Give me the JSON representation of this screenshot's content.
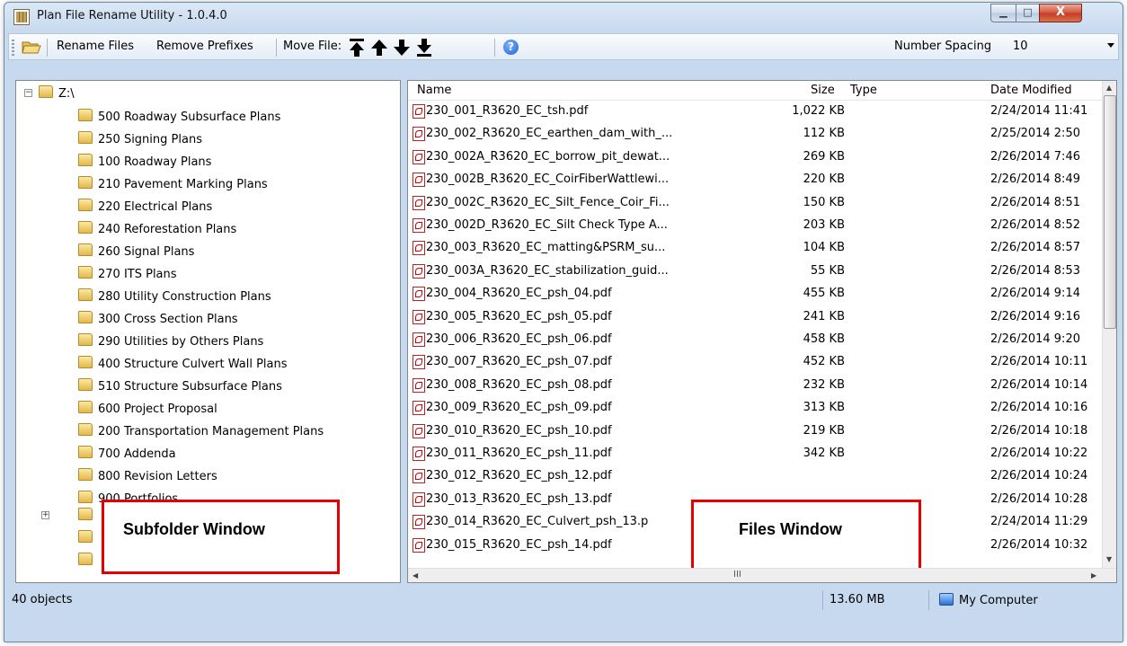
{
  "window": {
    "title": "Plan File Rename Utility - 1.0.4.0",
    "minimize_glyph": "▁",
    "maximize_glyph": "□",
    "close_glyph": "X"
  },
  "toolbar": {
    "rename_files": "Rename Files",
    "remove_prefixes": "Remove Prefixes",
    "move_file": "Move File:",
    "number_spacing_label": "Number Spacing",
    "number_spacing_value": "10",
    "help_glyph": "?"
  },
  "tree": {
    "root": "Z:\\",
    "folders": [
      "500 Roadway Subsurface Plans",
      "250 Signing Plans",
      "100 Roadway Plans",
      "210 Pavement Marking Plans",
      "220 Electrical Plans",
      "240 Reforestation Plans",
      "260 Signal Plans",
      "270 ITS Plans",
      "280 Utility Construction Plans",
      "300 Cross Section Plans",
      "290 Utilities by Others Plans",
      "400 Structure Culvert Wall Plans",
      "510 Structure Subsurface Plans",
      "600 Project Proposal",
      "200 Transportation Management Plans",
      "700 Addenda",
      "800 Revision Letters",
      "900 Portfolios"
    ],
    "collapse_glyph": "−",
    "expand_glyph": "+"
  },
  "files": {
    "columns": {
      "name": "Name",
      "size": "Size",
      "type": "Type",
      "date": "Date Modified"
    },
    "rows": [
      {
        "name": "230_001_R3620_EC_tsh.pdf",
        "size": "1,022 KB",
        "date": "2/24/2014 11:41"
      },
      {
        "name": "230_002_R3620_EC_earthen_dam_with_...",
        "size": "112 KB",
        "date": "2/25/2014 2:50"
      },
      {
        "name": "230_002A_R3620_EC_borrow_pit_dewat...",
        "size": "269 KB",
        "date": "2/26/2014 7:46"
      },
      {
        "name": "230_002B_R3620_EC_CoirFiberWattlewi...",
        "size": "220 KB",
        "date": "2/26/2014 8:49"
      },
      {
        "name": "230_002C_R3620_EC_Silt_Fence_Coir_Fi...",
        "size": "150 KB",
        "date": "2/26/2014 8:51"
      },
      {
        "name": "230_002D_R3620_EC_Silt Check Type A...",
        "size": "203 KB",
        "date": "2/26/2014 8:52"
      },
      {
        "name": "230_003_R3620_EC_matting&PSRM_su...",
        "size": "104 KB",
        "date": "2/26/2014 8:57"
      },
      {
        "name": "230_003A_R3620_EC_stabilization_guid...",
        "size": "55 KB",
        "date": "2/26/2014 8:53"
      },
      {
        "name": "230_004_R3620_EC_psh_04.pdf",
        "size": "455 KB",
        "date": "2/26/2014 9:14"
      },
      {
        "name": "230_005_R3620_EC_psh_05.pdf",
        "size": "241 KB",
        "date": "2/26/2014 9:16"
      },
      {
        "name": "230_006_R3620_EC_psh_06.pdf",
        "size": "458 KB",
        "date": "2/26/2014 9:20"
      },
      {
        "name": "230_007_R3620_EC_psh_07.pdf",
        "size": "452 KB",
        "date": "2/26/2014 10:11"
      },
      {
        "name": "230_008_R3620_EC_psh_08.pdf",
        "size": "232 KB",
        "date": "2/26/2014 10:14"
      },
      {
        "name": "230_009_R3620_EC_psh_09.pdf",
        "size": "313 KB",
        "date": "2/26/2014 10:16"
      },
      {
        "name": "230_010_R3620_EC_psh_10.pdf",
        "size": "219 KB",
        "date": "2/26/2014 10:18"
      },
      {
        "name": "230_011_R3620_EC_psh_11.pdf",
        "size": "342 KB",
        "date": "2/26/2014 10:22"
      },
      {
        "name": "230_012_R3620_EC_psh_12.pdf",
        "size": "",
        "date": "2/26/2014 10:24"
      },
      {
        "name": "230_013_R3620_EC_psh_13.pdf",
        "size": "",
        "date": "2/26/2014 10:28"
      },
      {
        "name": "230_014_R3620_EC_Culvert_psh_13.p",
        "size": "",
        "date": "2/24/2014 11:29"
      },
      {
        "name": "230_015_R3620_EC_psh_14.pdf",
        "size": "",
        "date": "2/26/2014 10:32"
      }
    ],
    "hscroll_grip": "III"
  },
  "status": {
    "objects": "40 objects",
    "size": "13.60 MB",
    "location": "My Computer"
  },
  "annotations": {
    "subfolder": "Subfolder Window",
    "files": "Files Window"
  }
}
